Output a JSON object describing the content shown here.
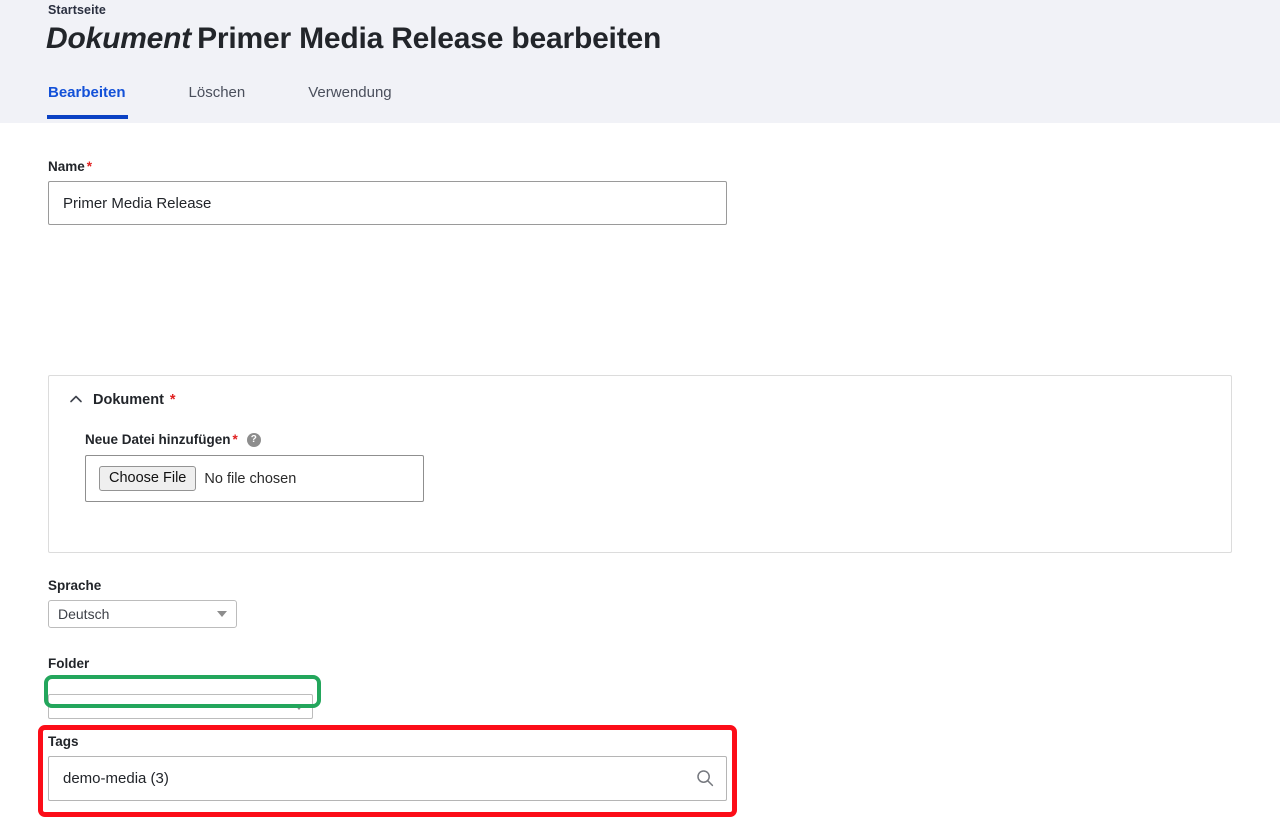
{
  "header": {
    "breadcrumb": "Startseite",
    "title_kind": "Dokument",
    "title_rest": "Primer Media Release bearbeiten",
    "tabs": [
      {
        "label": "Bearbeiten",
        "active": true
      },
      {
        "label": "Löschen",
        "active": false
      },
      {
        "label": "Verwendung",
        "active": false
      }
    ],
    "active_tab_color": "#1351d8",
    "background": "#f1f2f7"
  },
  "form": {
    "name": {
      "label": "Name",
      "required_marker": "*",
      "value": "Primer Media Release",
      "placeholder": ""
    },
    "document_panel": {
      "title": "Dokument",
      "required_marker": "*",
      "collapse_icon": "chevron-up-icon",
      "file_field": {
        "label": "Neue Datei hinzufügen",
        "required_marker": "*",
        "help_icon": "help-circle-icon",
        "help_glyph": "?",
        "button_label": "Choose File",
        "status_text": "No file chosen"
      }
    },
    "sprache": {
      "label": "Sprache",
      "value": "Deutsch",
      "caret_icon": "chevron-down-icon"
    },
    "folder": {
      "label": "Folder",
      "value": "",
      "caret_icon": "chevron-down-icon",
      "highlight_color": "#23a65c"
    },
    "tags": {
      "label": "Tags",
      "value": "demo-media (3)",
      "placeholder": "",
      "search_icon": "search-icon",
      "highlight_color": "#fc0d18"
    }
  }
}
